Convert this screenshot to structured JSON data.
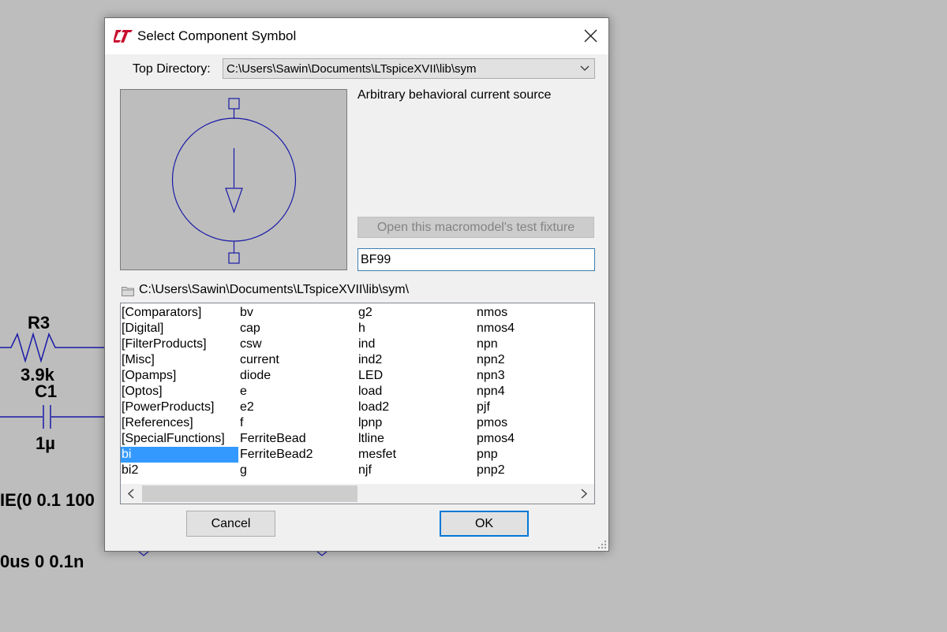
{
  "schematic": {
    "r3_name": "R3",
    "r3_value": "3.9k",
    "c1_name": "C1",
    "c1_value": "1µ",
    "source_line": "IE(0 0.1 100",
    "pulse_line": "0us 0 0.1n"
  },
  "dialog": {
    "title": "Select Component Symbol",
    "top_directory_label": "Top Directory:",
    "top_directory_value": "C:\\Users\\Sawin\\Documents\\LTspiceXVII\\lib\\sym",
    "description": "Arbitrary behavioral current source",
    "test_fixture_label": "Open this macromodel's test fixture",
    "search_value": "BF99",
    "current_path": "C:\\Users\\Sawin\\Documents\\LTspiceXVII\\lib\\sym\\",
    "selected_item": "bi",
    "columns": [
      [
        "[Comparators]",
        "[Digital]",
        "[FilterProducts]",
        "[Misc]",
        "[Opamps]",
        "[Optos]",
        "[PowerProducts]",
        "[References]",
        "[SpecialFunctions]",
        "bi",
        "bi2"
      ],
      [
        "bv",
        "cap",
        "csw",
        "current",
        "diode",
        "e",
        "e2",
        "f",
        "FerriteBead",
        "FerriteBead2",
        "g"
      ],
      [
        "g2",
        "h",
        "ind",
        "ind2",
        "LED",
        "load",
        "load2",
        "lpnp",
        "ltline",
        "mesfet",
        "njf"
      ],
      [
        "nmos",
        "nmos4",
        "npn",
        "npn2",
        "npn3",
        "npn4",
        "pjf",
        "pmos",
        "pmos4",
        "pnp",
        "pnp2"
      ]
    ],
    "cancel_label": "Cancel",
    "ok_label": "OK"
  },
  "colors": {
    "accent": "#0078d7",
    "selection": "#3399ff",
    "symbol_stroke": "#1a1aa8",
    "background": "#bdbdbd"
  }
}
